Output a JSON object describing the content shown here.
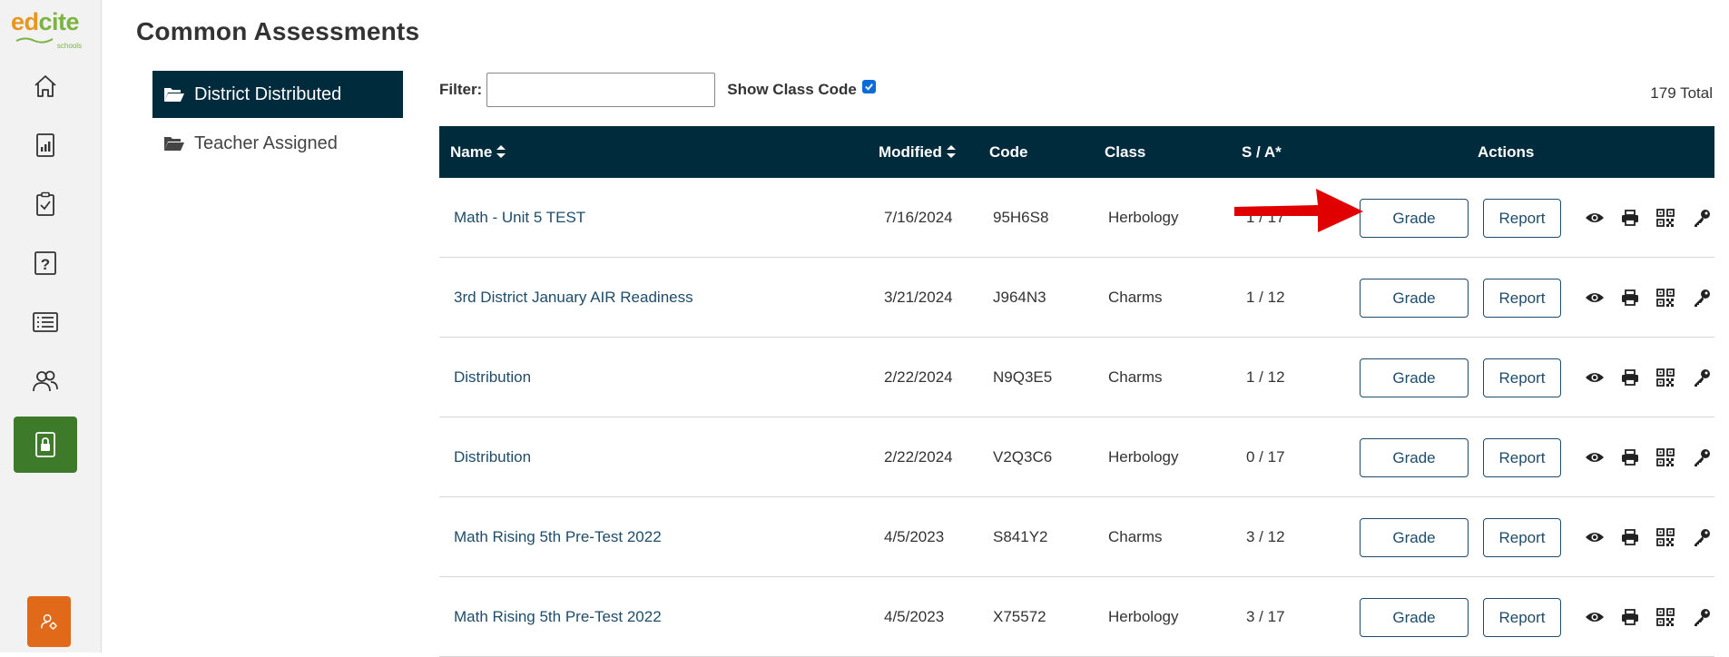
{
  "brand": {
    "logo_part1": "ed",
    "logo_part2": "cite",
    "logo_sub": "schools"
  },
  "colors": {
    "header_bg": "#002b3d",
    "link": "#1e4c6b",
    "rail_active": "#3d7a2a",
    "user_btn": "#e06a1a",
    "arrow": "#e00000"
  },
  "rail": {
    "items": [
      {
        "name": "home-icon"
      },
      {
        "name": "reports-icon"
      },
      {
        "name": "assessments-icon"
      },
      {
        "name": "question-icon"
      },
      {
        "name": "list-icon"
      },
      {
        "name": "users-icon"
      },
      {
        "name": "lock-icon"
      }
    ],
    "user_icon": "user-settings-icon"
  },
  "page": {
    "title": "Common Assessments"
  },
  "folders": [
    {
      "label": "District Distributed",
      "active": true
    },
    {
      "label": "Teacher Assigned",
      "active": false
    }
  ],
  "filter": {
    "label": "Filter:",
    "value": "",
    "show_class_code_label": "Show Class Code",
    "show_class_code_checked": true
  },
  "total": "179 Total",
  "table": {
    "headers": {
      "name": "Name",
      "modified": "Modified",
      "code": "Code",
      "class": "Class",
      "sa": "S / A*",
      "actions": "Actions"
    },
    "rows": [
      {
        "name": "Math - Unit 5 TEST",
        "modified": "7/16/2024",
        "code": "95H6S8",
        "class": "Herbology",
        "sa": "1 / 17"
      },
      {
        "name": "3rd District January AIR Readiness",
        "modified": "3/21/2024",
        "code": "J964N3",
        "class": "Charms",
        "sa": "1 / 12"
      },
      {
        "name": "Distribution",
        "modified": "2/22/2024",
        "code": "N9Q3E5",
        "class": "Charms",
        "sa": "1 / 12"
      },
      {
        "name": "Distribution",
        "modified": "2/22/2024",
        "code": "V2Q3C6",
        "class": "Herbology",
        "sa": "0 / 17"
      },
      {
        "name": "Math Rising 5th Pre-Test 2022",
        "modified": "4/5/2023",
        "code": "S841Y2",
        "class": "Charms",
        "sa": "3 / 12"
      },
      {
        "name": "Math Rising 5th Pre-Test 2022",
        "modified": "4/5/2023",
        "code": "X75572",
        "class": "Herbology",
        "sa": "3 / 17"
      }
    ],
    "grade_label": "Grade",
    "report_label": "Report",
    "action_icons": [
      "eye-icon",
      "print-icon",
      "qr-code-icon",
      "key-icon"
    ]
  }
}
